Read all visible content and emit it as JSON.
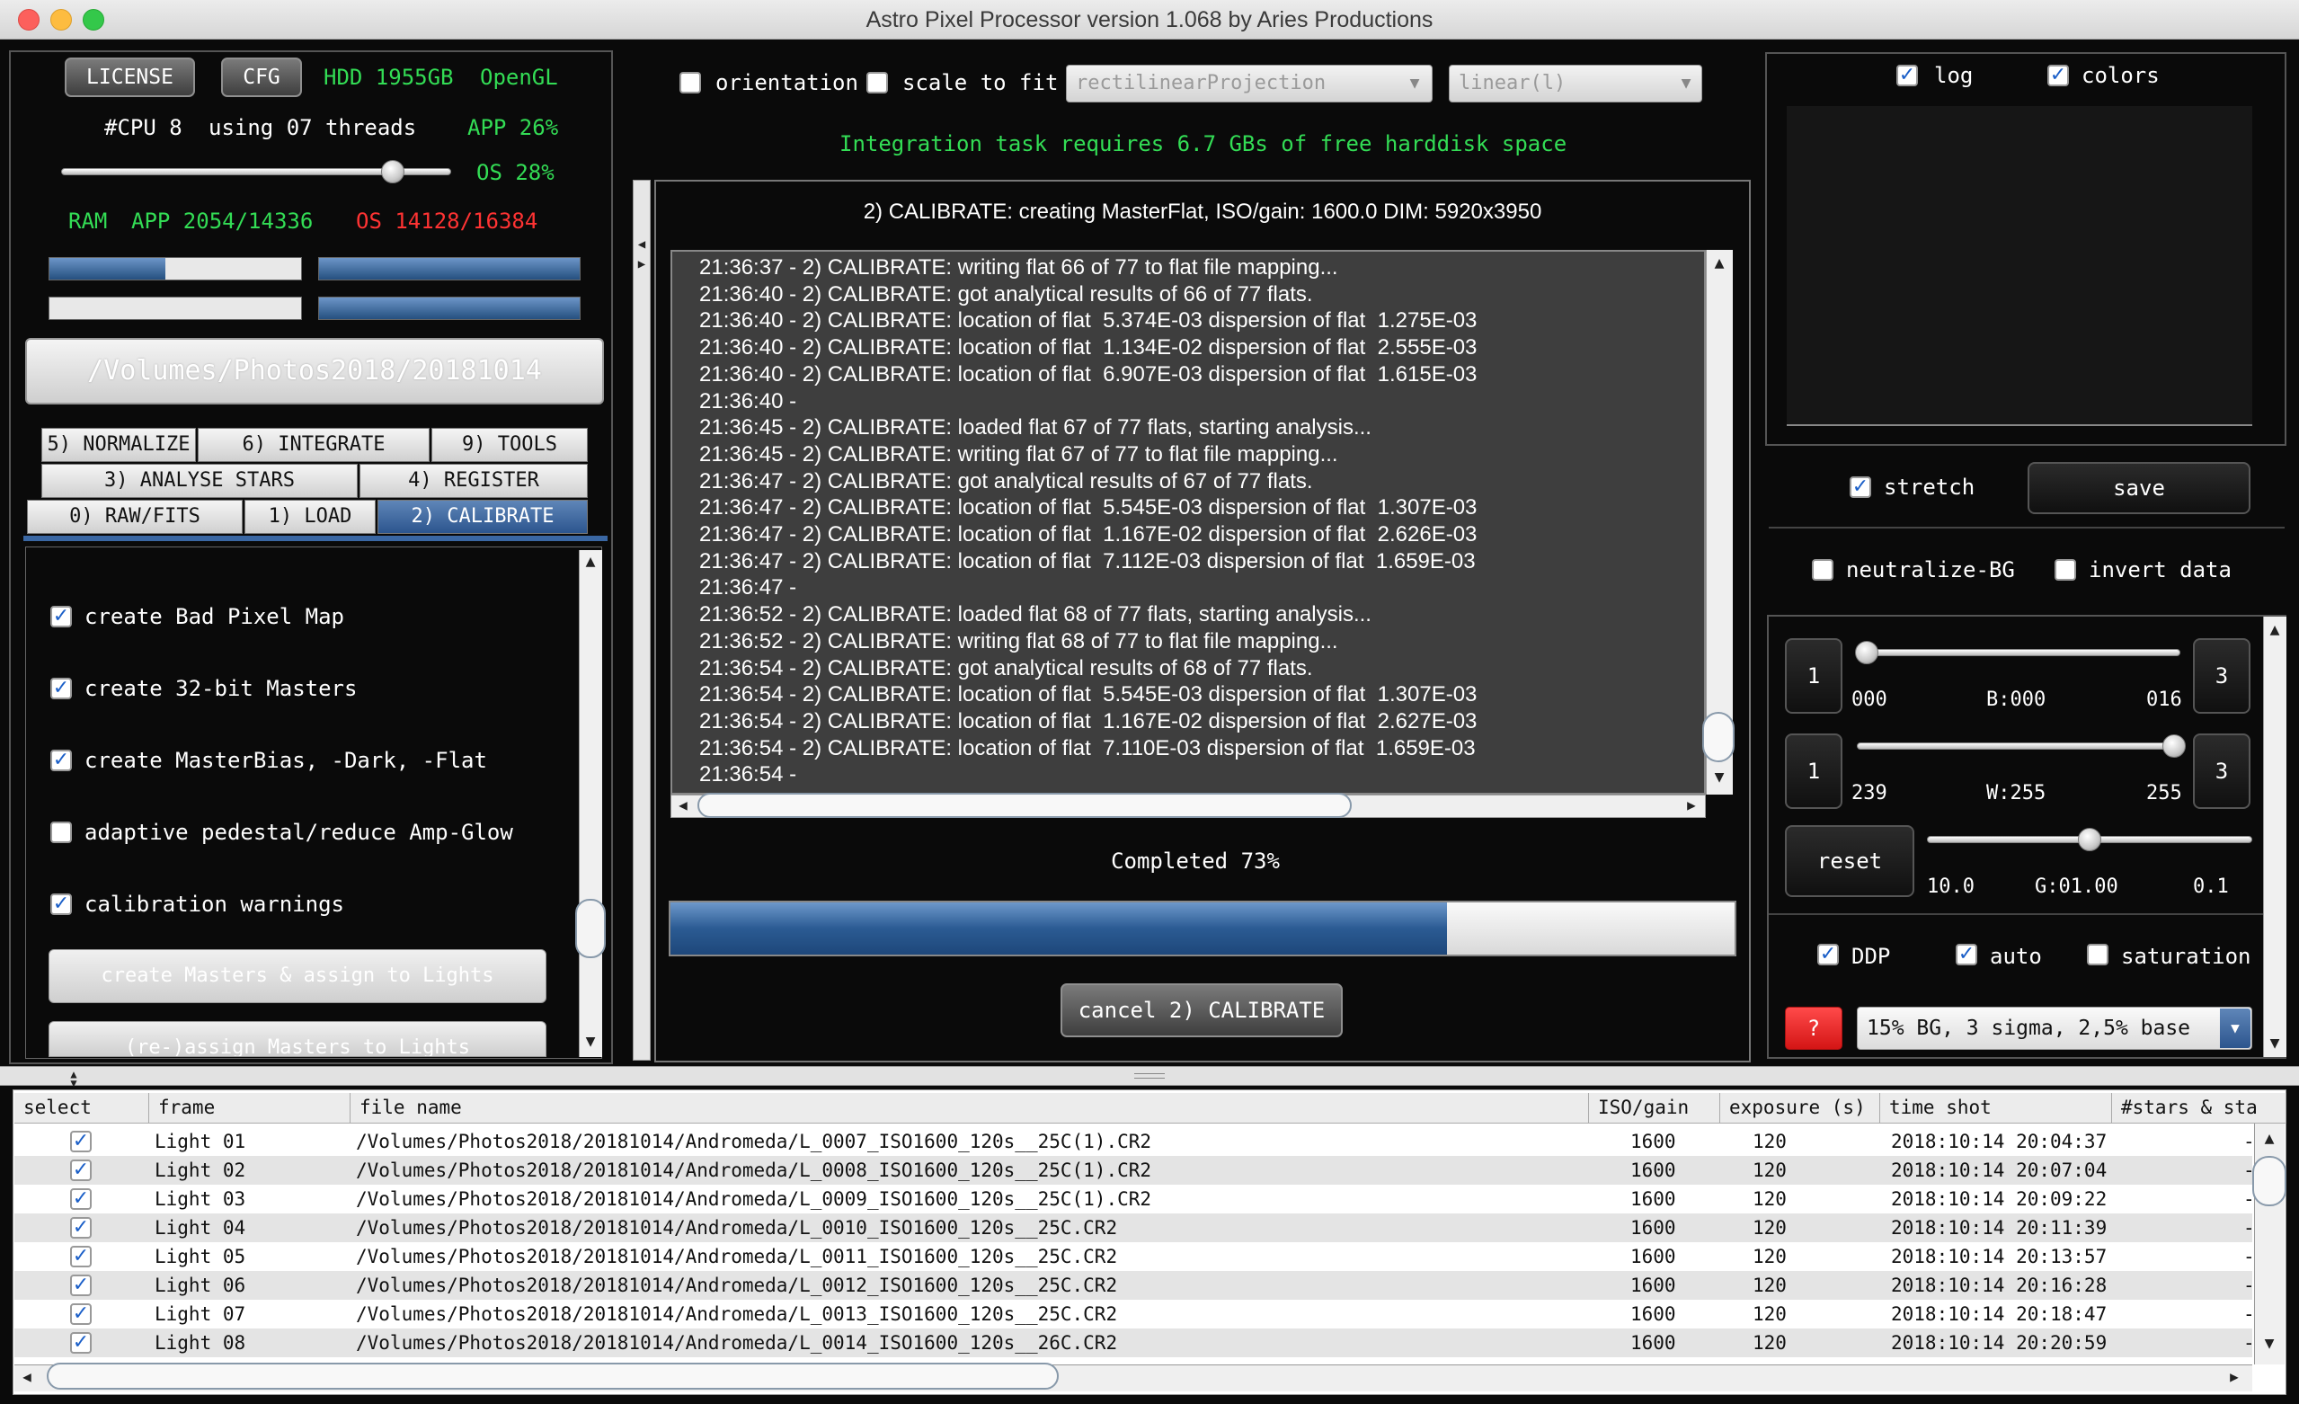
{
  "window": {
    "title": "Astro Pixel Processor version 1.068 by Aries Productions"
  },
  "left": {
    "license": "LICENSE",
    "cfg": "CFG",
    "hdd": "HDD 1955GB",
    "opengl": "OpenGL",
    "cpu": "#CPU 8",
    "threads": "using 07 threads",
    "app_cpu": "APP 26%",
    "os_cpu": "OS 28%",
    "thread_slider": 0.85,
    "ram_label": "RAM",
    "ram_app": "APP 2054/14336",
    "ram_os": "OS 14128/16384",
    "mem_bars": [
      0.46,
      1.0,
      0.0,
      1.0
    ],
    "folder": "/Volumes/Photos2018/20181014",
    "tabs_row1": [
      "5) NORMALIZE",
      "6) INTEGRATE",
      "9) TOOLS"
    ],
    "tabs_row2": [
      "3) ANALYSE STARS",
      "4) REGISTER"
    ],
    "tabs_row3": [
      "0) RAW/FITS",
      "1) LOAD",
      "2) CALIBRATE"
    ],
    "options": [
      {
        "label": "create Bad Pixel Map",
        "checked": true
      },
      {
        "label": "create 32-bit Masters",
        "checked": true
      },
      {
        "label": "create MasterBias, -Dark, -Flat",
        "checked": true
      },
      {
        "label": "adaptive pedestal/reduce Amp-Glow",
        "checked": false
      },
      {
        "label": "calibration warnings",
        "checked": true
      }
    ],
    "btn_create": "create Masters & assign to Lights",
    "btn_reassign": "(re-)assign Masters to Lights"
  },
  "center": {
    "orientation": "orientation",
    "scale_to_fit": "scale to fit",
    "projection": "rectilinearProjection",
    "stretch_mode": "linear(l)",
    "disk_msg": "Integration task requires 6.7 GBs of free harddisk space",
    "task_title": "2) CALIBRATE: creating MasterFlat, ISO/gain: 1600.0 DIM: 5920x3950",
    "log": [
      "21:36:37 - 2) CALIBRATE: writing flat 66 of 77 to flat file mapping...",
      "21:36:40 - 2) CALIBRATE: got analytical results of 66 of 77 flats.",
      "21:36:40 - 2) CALIBRATE: location of flat  5.374E-03 dispersion of flat  1.275E-03",
      "21:36:40 - 2) CALIBRATE: location of flat  1.134E-02 dispersion of flat  2.555E-03",
      "21:36:40 - 2) CALIBRATE: location of flat  6.907E-03 dispersion of flat  1.615E-03",
      "21:36:40 -",
      "21:36:45 - 2) CALIBRATE: loaded flat 67 of 77 flats, starting analysis...",
      "21:36:45 - 2) CALIBRATE: writing flat 67 of 77 to flat file mapping...",
      "21:36:47 - 2) CALIBRATE: got analytical results of 67 of 77 flats.",
      "21:36:47 - 2) CALIBRATE: location of flat  5.545E-03 dispersion of flat  1.307E-03",
      "21:36:47 - 2) CALIBRATE: location of flat  1.167E-02 dispersion of flat  2.626E-03",
      "21:36:47 - 2) CALIBRATE: location of flat  7.112E-03 dispersion of flat  1.659E-03",
      "21:36:47 -",
      "21:36:52 - 2) CALIBRATE: loaded flat 68 of 77 flats, starting analysis...",
      "21:36:52 - 2) CALIBRATE: writing flat 68 of 77 to flat file mapping...",
      "21:36:54 - 2) CALIBRATE: got analytical results of 68 of 77 flats.",
      "21:36:54 - 2) CALIBRATE: location of flat  5.545E-03 dispersion of flat  1.307E-03",
      "21:36:54 - 2) CALIBRATE: location of flat  1.167E-02 dispersion of flat  2.627E-03",
      "21:36:54 - 2) CALIBRATE: location of flat  7.110E-03 dispersion of flat  1.659E-03",
      "21:36:54 -"
    ],
    "completed": "Completed 73%",
    "progress": 0.73,
    "cancel": "cancel 2) CALIBRATE"
  },
  "right": {
    "log_cb": "log",
    "colors_cb": "colors",
    "stretch": "stretch",
    "save": "save",
    "neutralize": "neutralize-BG",
    "invert": "invert data",
    "s1_min": "000",
    "s1_mid": "B:000",
    "s1_max": "016",
    "s1_val": 0.03,
    "s2_min": "239",
    "s2_mid": "W:255",
    "s2_max": "255",
    "s2_val": 0.98,
    "s3_min": "10.0",
    "s3_mid": "G:01.00",
    "s3_max": "0.1",
    "s3_val": 0.5,
    "one": "1",
    "three": "3",
    "reset": "reset",
    "ddp": "DDP",
    "auto": "auto",
    "saturation": "saturation",
    "help": "?",
    "preset": "15% BG, 3 sigma, 2,5% base"
  },
  "table": {
    "headers": [
      "select",
      "frame",
      "file name",
      "ISO/gain",
      "exposure (s)",
      "time shot",
      "#stars & sta"
    ],
    "rows": [
      {
        "frame": "Light 01",
        "file": "/Volumes/Photos2018/20181014/Andromeda/L_0007_ISO1600_120s__25C(1).CR2",
        "iso": "1600",
        "exp": "120",
        "time": "2018:10:14  20:04:37",
        "stars": "-"
      },
      {
        "frame": "Light 02",
        "file": "/Volumes/Photos2018/20181014/Andromeda/L_0008_ISO1600_120s__25C(1).CR2",
        "iso": "1600",
        "exp": "120",
        "time": "2018:10:14  20:07:04",
        "stars": "-"
      },
      {
        "frame": "Light 03",
        "file": "/Volumes/Photos2018/20181014/Andromeda/L_0009_ISO1600_120s__25C(1).CR2",
        "iso": "1600",
        "exp": "120",
        "time": "2018:10:14  20:09:22",
        "stars": "-"
      },
      {
        "frame": "Light 04",
        "file": "/Volumes/Photos2018/20181014/Andromeda/L_0010_ISO1600_120s__25C.CR2",
        "iso": "1600",
        "exp": "120",
        "time": "2018:10:14  20:11:39",
        "stars": "-"
      },
      {
        "frame": "Light 05",
        "file": "/Volumes/Photos2018/20181014/Andromeda/L_0011_ISO1600_120s__25C.CR2",
        "iso": "1600",
        "exp": "120",
        "time": "2018:10:14  20:13:57",
        "stars": "-"
      },
      {
        "frame": "Light 06",
        "file": "/Volumes/Photos2018/20181014/Andromeda/L_0012_ISO1600_120s__25C.CR2",
        "iso": "1600",
        "exp": "120",
        "time": "2018:10:14  20:16:28",
        "stars": "-"
      },
      {
        "frame": "Light 07",
        "file": "/Volumes/Photos2018/20181014/Andromeda/L_0013_ISO1600_120s__25C.CR2",
        "iso": "1600",
        "exp": "120",
        "time": "2018:10:14  20:18:47",
        "stars": "-"
      },
      {
        "frame": "Light 08",
        "file": "/Volumes/Photos2018/20181014/Andromeda/L_0014_ISO1600_120s__26C.CR2",
        "iso": "1600",
        "exp": "120",
        "time": "2018:10:14  20:20:59",
        "stars": "-"
      }
    ]
  }
}
